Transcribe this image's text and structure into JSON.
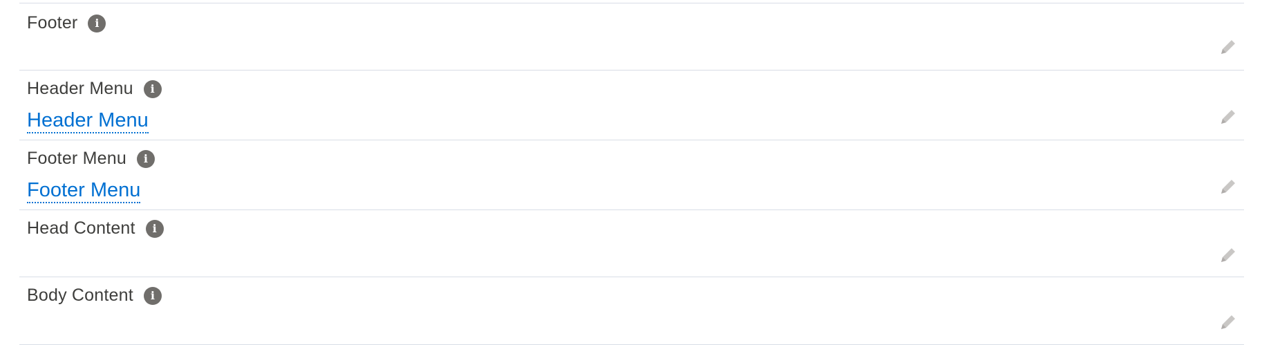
{
  "fields": [
    {
      "label": "Footer",
      "value": ""
    },
    {
      "label": "Header Menu",
      "value": "Header Menu"
    },
    {
      "label": "Footer Menu",
      "value": "Footer Menu"
    },
    {
      "label": "Head Content",
      "value": ""
    },
    {
      "label": "Body Content",
      "value": ""
    }
  ],
  "colors": {
    "link": "#0070d2",
    "label": "#3e3e3c",
    "info_icon": "#706e6b",
    "edit_icon": "#c9c7c5",
    "divider": "#d8dde6"
  },
  "icons": {
    "info": "info-icon",
    "edit": "pencil-icon"
  }
}
